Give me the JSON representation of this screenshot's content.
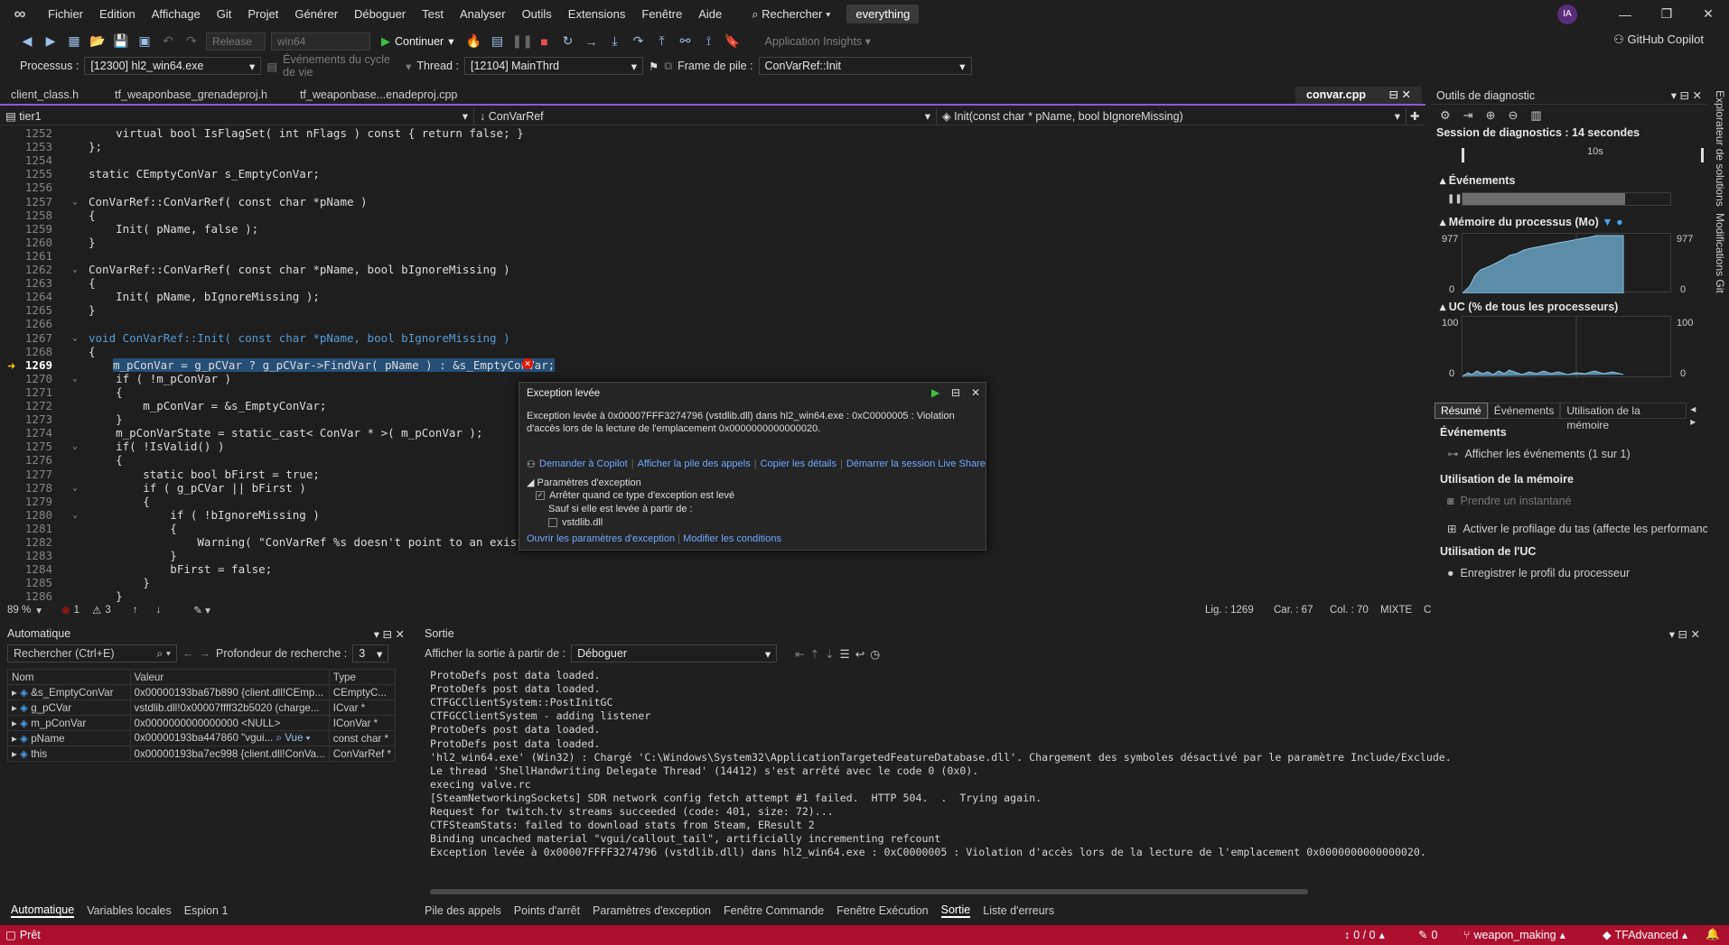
{
  "menu": {
    "items": [
      "Fichier",
      "Edition",
      "Affichage",
      "Git",
      "Projet",
      "Générer",
      "Déboguer",
      "Test",
      "Analyser",
      "Outils",
      "Extensions",
      "Fenêtre",
      "Aide"
    ],
    "search": "Rechercher",
    "search_box": "everything",
    "avatar": "IA"
  },
  "toolbar": {
    "config": "Release",
    "platform": "win64",
    "continue": "Continuer",
    "app_insights": "Application Insights",
    "copilot": "GitHub Copilot"
  },
  "debugbar": {
    "process_label": "Processus :",
    "process": "[12300] hl2_win64.exe",
    "lifecycle": "Événements du cycle de vie",
    "thread_label": "Thread :",
    "thread": "[12104] MainThrd",
    "frame_label": "Frame de pile :",
    "frame": "ConVarRef::Init"
  },
  "tabs": {
    "t1": "client_class.h",
    "t2": "tf_weaponbase_grenadeproj.h",
    "t3": "tf_weaponbase...enadeproj.cpp",
    "active": "convar.cpp"
  },
  "nav": {
    "project": "tier1",
    "scope": "ConVarRef",
    "member": "Init(const char * pName, bool bIgnoreMissing)"
  },
  "code": {
    "l1252": "    virtual bool IsFlagSet( int nFlags ) const { return false; }",
    "l1253": "};",
    "l1255": "static CEmptyConVar s_EmptyConVar;",
    "l1257": "ConVarRef::ConVarRef( const char *pName )",
    "l1258": "{",
    "l1259": "    Init( pName, false );",
    "l1260": "}",
    "l1262": "ConVarRef::ConVarRef( const char *pName, bool bIgnoreMissing )",
    "l1263": "{",
    "l1264": "    Init( pName, bIgnoreMissing );",
    "l1265": "}",
    "l1267": "void ConVarRef::Init( const char *pName, bool bIgnoreMissing )",
    "l1268": "{",
    "l1269": "m_pConVar = g_pCVar ? g_pCVar->FindVar( pName ) : &s_EmptyConVar;",
    "l1270": "    if ( !m_pConVar )",
    "l1271": "    {",
    "l1272": "        m_pConVar = &s_EmptyConVar;",
    "l1273": "    }",
    "l1274": "    m_pConVarState = static_cast< ConVar * >( m_pConVar );",
    "l1275": "    if( !IsValid() )",
    "l1276": "    {",
    "l1277": "        static bool bFirst = true;",
    "l1278": "        if ( g_pCVar || bFirst )",
    "l1279": "        {",
    "l1280": "            if ( !bIgnoreMissing )",
    "l1281": "            {",
    "l1282": "                Warning( \"ConVarRef %s doesn't point to an existing Co",
    "l1283": "            }",
    "l1284": "            bFirst = false;",
    "l1285": "        }",
    "l1286": "    }"
  },
  "exception": {
    "title": "Exception levée",
    "msg": "Exception levée à 0x00007FFF3274796 (vstdlib.dll) dans hl2_win64.exe : 0xC0000005 : Violation d'accès lors de la lecture de l'emplacement 0x0000000000000020.",
    "ask": "Demander à Copilot",
    "stack": "Afficher la pile des appels",
    "copy": "Copier les détails",
    "live": "Démarrer la session Live Share",
    "params": "Paramètres d'exception",
    "break": "Arrêter quand ce type d'exception est levé",
    "except": "Sauf si elle est levée à partir de :",
    "dll": "vstdlib.dll",
    "open": "Ouvrir les paramètres d'exception",
    "modify": "Modifier les conditions"
  },
  "edstatus": {
    "zoom": "89 %",
    "errors": "1",
    "warnings": "3",
    "line": "Lig. : 1269",
    "char": "Car. : 67",
    "col": "Col. : 70",
    "mode": "MIXTE",
    "eol": "CRLF"
  },
  "diag": {
    "title": "Outils de diagnostic",
    "session": "Session de diagnostics : 14 secondes",
    "tick": "10s",
    "events": "Événements",
    "memory": "Mémoire du processus (Mo)",
    "mem_max": "977",
    "mem_min": "0",
    "cpu": "UC (% de tous les processeurs)",
    "cpu_max": "100",
    "cpu_min": "0",
    "tabs": [
      "Résumé",
      "Événements",
      "Utilisation de la mémoire"
    ],
    "ev_head": "Événements",
    "ev_show": "Afficher les événements (1 sur 1)",
    "mem_head": "Utilisation de la mémoire",
    "snapshot": "Prendre un instantané",
    "heap": "Activer le profilage du tas (affecte les performances)",
    "cpu_head": "Utilisation de l'UC",
    "cpu_rec": "Enregistrer le profil du processeur"
  },
  "sidetabs": {
    "a": "Explorateur de solutions",
    "b": "Modifications Git"
  },
  "autos": {
    "title": "Automatique",
    "search": "Rechercher (Ctrl+E)",
    "depth_label": "Profondeur de recherche :",
    "depth": "3",
    "cols": [
      "Nom",
      "Valeur",
      "Type"
    ],
    "rows": [
      [
        "&s_EmptyConVar",
        "0x00000193ba67b890 {client.dll!CEmp...",
        "CEmptyC..."
      ],
      [
        "g_pCVar",
        "vstdlib.dll!0x00007ffff32b5020 (charge...",
        "ICvar *"
      ],
      [
        "m_pConVar",
        "0x0000000000000000 <NULL>",
        "IConVar *"
      ],
      [
        "pName",
        "0x00000193ba447860 \"vgui...",
        "const char *"
      ],
      [
        "this",
        "0x00000193ba7ec998 {client.dll!ConVa...",
        "ConVarRef *"
      ]
    ],
    "view": "Vue",
    "tabs": [
      "Automatique",
      "Variables locales",
      "Espion 1"
    ]
  },
  "output": {
    "title": "Sortie",
    "from_label": "Afficher la sortie à partir de :",
    "from": "Déboguer",
    "lines": [
      "ProtoDefs post data loaded.",
      "ProtoDefs post data loaded.",
      "CTFGCClientSystem::PostInitGC",
      "CTFGCClientSystem - adding listener",
      "ProtoDefs post data loaded.",
      "ProtoDefs post data loaded.",
      "'hl2_win64.exe' (Win32) : Chargé 'C:\\Windows\\System32\\ApplicationTargetedFeatureDatabase.dll'. Chargement des symboles désactivé par le paramètre Include/Exclude.",
      "Le thread 'ShellHandwriting Delegate Thread' (14412) s'est arrêté avec le code 0 (0x0).",
      "execing valve.rc",
      "[SteamNetworkingSockets] SDR network config fetch attempt #1 failed.  HTTP 504.  .  Trying again.",
      "Request for twitch.tv streams succeeded (code: 401, size: 72)...",
      "CTFSteamStats: failed to download stats from Steam, EResult 2",
      "Binding uncached material \"vgui/callout_tail\", artificially incrementing refcount",
      "Exception levée à 0x00007FFFF3274796 (vstdlib.dll) dans hl2_win64.exe : 0xC0000005 : Violation d'accès lors de la lecture de l'emplacement 0x0000000000000020."
    ],
    "tabs": [
      "Pile des appels",
      "Points d'arrêt",
      "Paramètres d'exception",
      "Fenêtre Commande",
      "Fenêtre Exécution",
      "Sortie",
      "Liste d'erreurs"
    ]
  },
  "status": {
    "ready": "Prêt",
    "changes": "0 / 0",
    "edits": "0",
    "branch": "weapon_making",
    "repo": "TFAdvanced"
  },
  "colors": {
    "accent": "#8a5ad1",
    "status": "#ad0f2e",
    "error": "#e51400"
  }
}
